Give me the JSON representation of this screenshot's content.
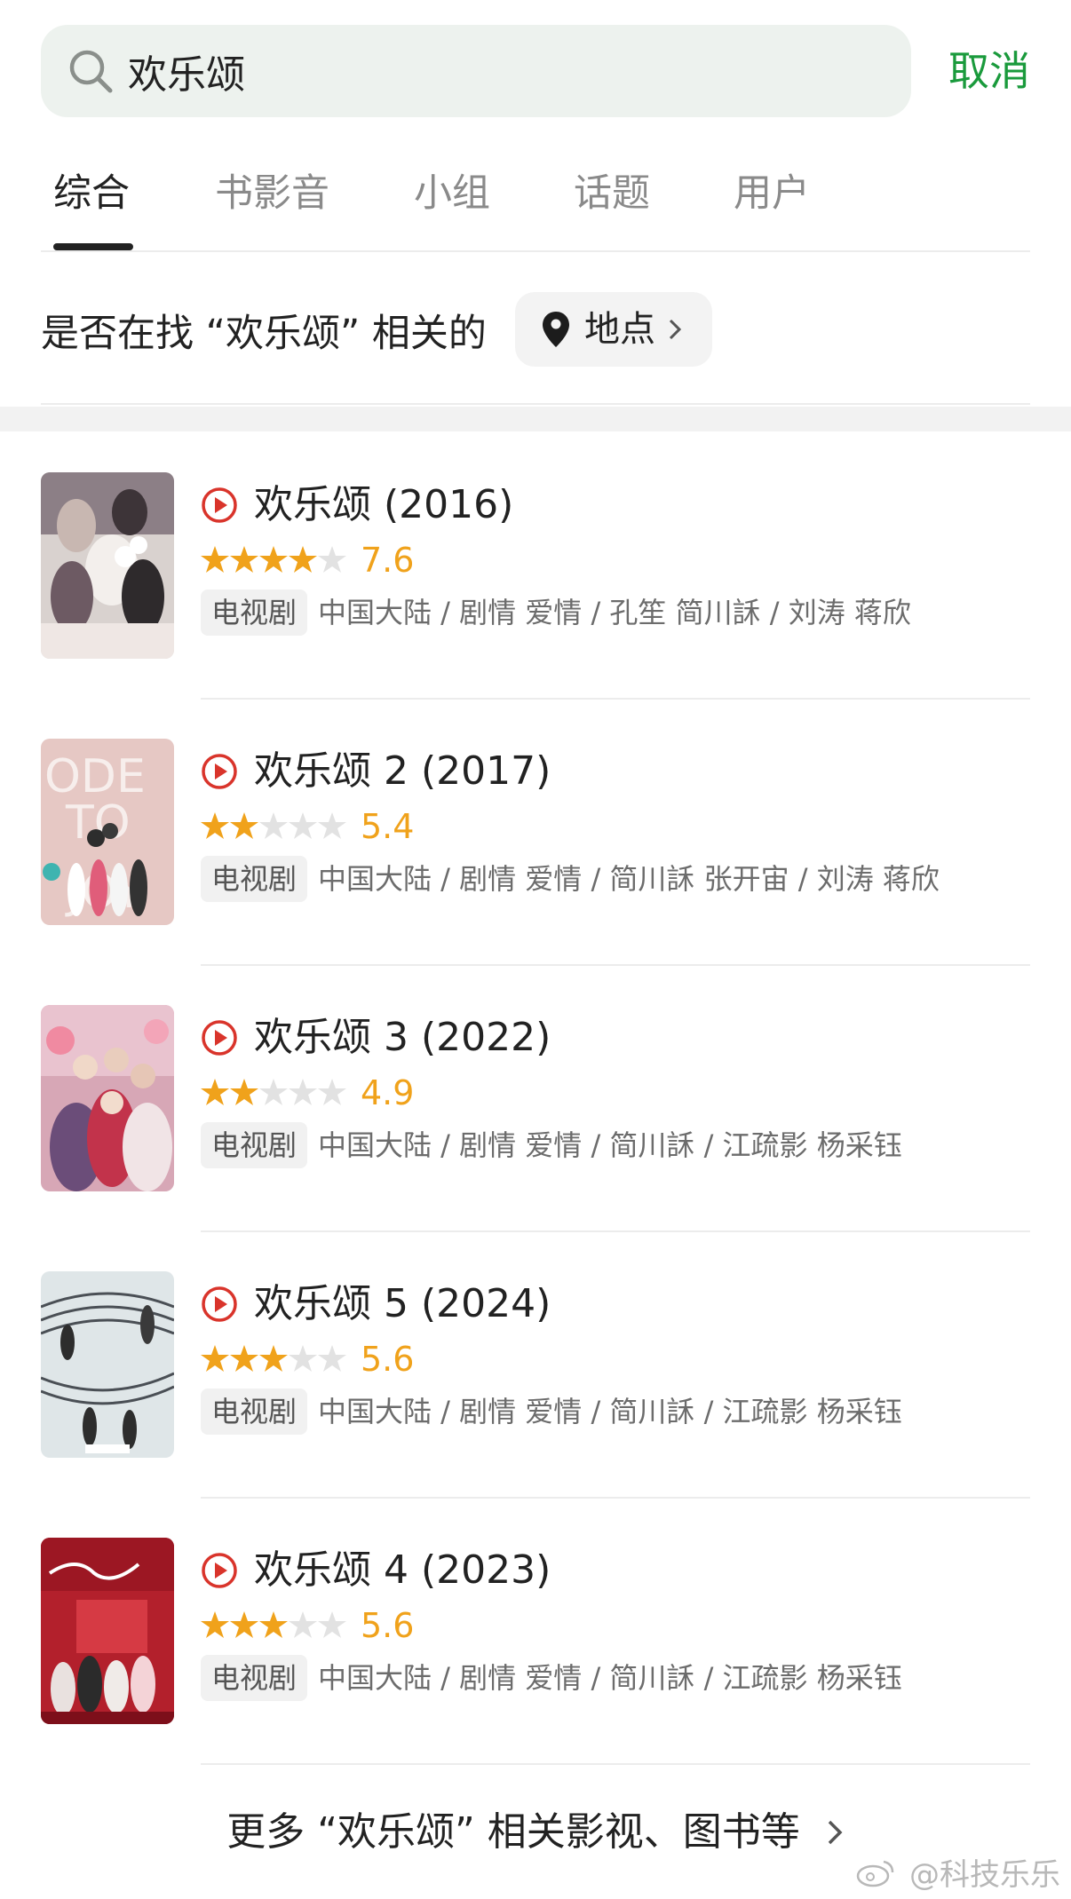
{
  "search": {
    "value": "欢乐颂",
    "cancel_label": "取消"
  },
  "tabs": [
    "综合",
    "书影音",
    "小组",
    "话题",
    "用户"
  ],
  "suggestion": {
    "text": "是否在找 “欢乐颂” 相关的",
    "chip_label": "地点"
  },
  "results": [
    {
      "title": "欢乐颂 (2016)",
      "rating": "7.6",
      "stars": 4,
      "tag": "电视剧",
      "meta": "中国大陆 / 剧情 爱情 / 孔笙 简川訸 / 刘涛 蒋欣"
    },
    {
      "title": "欢乐颂 2 (2017)",
      "rating": "5.4",
      "stars": 2.5,
      "tag": "电视剧",
      "meta": "中国大陆 / 剧情 爱情 / 简川訸 张开宙 / 刘涛 蒋欣"
    },
    {
      "title": "欢乐颂 3 (2022)",
      "rating": "4.9",
      "stars": 2.5,
      "tag": "电视剧",
      "meta": "中国大陆 / 剧情 爱情 / 简川訸 / 江疏影 杨采钰"
    },
    {
      "title": "欢乐颂 5 (2024)",
      "rating": "5.6",
      "stars": 3,
      "tag": "电视剧",
      "meta": "中国大陆 / 剧情 爱情 / 简川訸 / 江疏影 杨采钰"
    },
    {
      "title": "欢乐颂 4 (2023)",
      "rating": "5.6",
      "stars": 3,
      "tag": "电视剧",
      "meta": "中国大陆 / 剧情 爱情 / 简川訸 / 江疏影 杨采钰"
    }
  ],
  "more_link": "更多 “欢乐颂” 相关影视、图书等",
  "watermark": "@科技乐乐",
  "colors": {
    "accent_green": "#1a9a3c",
    "star_orange": "#f0a21b",
    "play_red": "#d9342b"
  }
}
